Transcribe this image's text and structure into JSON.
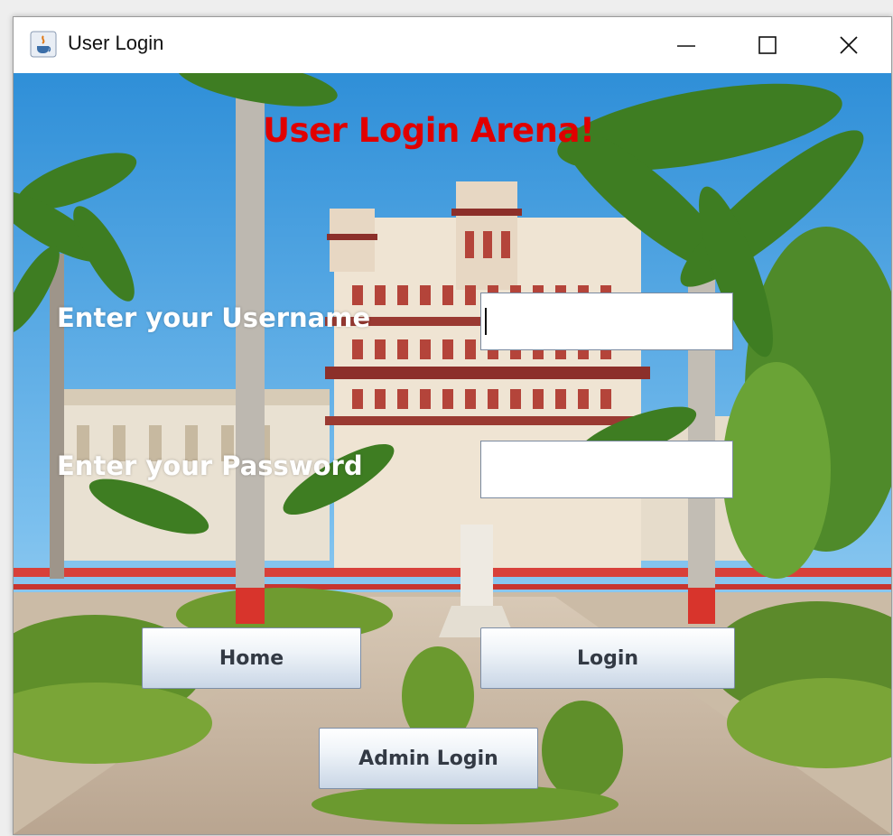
{
  "window": {
    "title": "User Login",
    "controls": {
      "minimize": "minimize",
      "maximize": "maximize",
      "close": "close"
    }
  },
  "form": {
    "heading": "User Login Arena!",
    "username_label": "Enter your Username",
    "username_value": "",
    "password_label": "Enter your Password",
    "password_value": ""
  },
  "buttons": {
    "home": "Home",
    "login": "Login",
    "admin_login": "Admin Login"
  },
  "colors": {
    "heading": "#e00000",
    "label": "#ffffff",
    "button_text": "#333a44"
  },
  "icons": [
    "java-app-icon",
    "minimize-icon",
    "maximize-icon",
    "close-icon"
  ]
}
